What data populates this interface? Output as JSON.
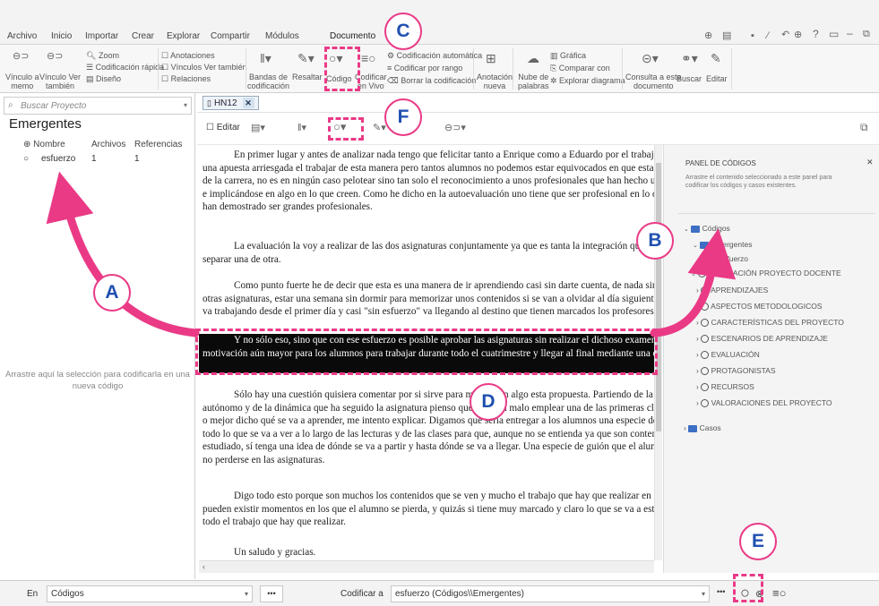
{
  "menu": [
    "Archivo",
    "Inicio",
    "Importar",
    "Crear",
    "Explorar",
    "Compartir",
    "Módulos",
    "Documento"
  ],
  "ribbon": {
    "vinculo_memo": "Vínculo a\nmemo",
    "vinculo_tambien": "Vínculo Ver\ntambién",
    "zoom": "Zoom",
    "codificacion_rapida": "Codificación rápida",
    "diseno": "Diseño",
    "anotaciones": "Anotaciones",
    "vinculos_ver_tambien": "Vínculos Ver también",
    "relaciones": "Relaciones",
    "bandas": "Bandas de\ncodificación",
    "resaltar": "Resaltar",
    "codigo": "Código",
    "codificar_vivo": "Codificar\nen Vivo",
    "codificacion_automatica": "Codificación automática",
    "codificar_por_rango": "Codificar por rango",
    "borrar_codificacion": "Borrar la codificación",
    "anotacion_nueva": "Anotación\nnueva",
    "nube_palabras": "Nube de\npalabras",
    "grafica": "Gráfica",
    "comparar_con": "Comparar con",
    "explorar_diagrama": "Explorar diagrama",
    "consulta_documento": "Consulta a este\ndocumento",
    "buscar": "Buscar",
    "editar": "Editar"
  },
  "left": {
    "search_placeholder": "Buscar Proyecto",
    "title": "Emergentes",
    "headers": [
      "Nombre",
      "Archivos",
      "Referencias"
    ],
    "rows": [
      {
        "name": "esfuerzo",
        "files": "1",
        "refs": "1"
      }
    ],
    "drop_text": "Arrastre aquí la selección para codificarla en una\nnueva código"
  },
  "doc_tab": "HN12",
  "doc_toolbar": {
    "editar": "Editar"
  },
  "document": {
    "p1": "En primer lugar y antes de analizar nada tengo que felicitar tanto a Enrique como a Eduardo por el trabajo realizado, me parece una apuesta arriesgada el trabajar de esta manera pero tantos alumnos no podemos estar equivocados en que esta es la mejor asignatura de la carrera, no es en ningún caso pelotear sino tan solo el reconocimiento a unos profesionales que han hecho un gran labor luchando e implicándose en algo en lo que creen. Como he dicho en la autoevaluación uno tiene que ser profesional en lo que trabaja y los dos han demostrado ser grandes profesionales.",
    "p2": "La evaluación la voy a realizar de las dos asignaturas conjuntamente ya que es tanta la integración que tienen que sería difícil separar una de otra.",
    "p3": "Como punto fuerte he de decir que esta es una manera de ir aprendiendo casi sin darte cuenta, de nada sirve, como ocurre en otras asignaturas, estar una semana sin dormir para memorizar unos contenidos si se van a olvidar al día siguiente. De esta manera uno va trabajando desde el primer día y casi \"sin esfuerzo\" va llegando al destino que tienen marcados los profesores.",
    "p4": "Y no sólo eso, sino que con ese esfuerzo es posible aprobar las asignaturas sin realizar el dichoso examen, lo que supone una motivación aún mayor para los alumnos para trabajar durante todo el cuatrimestre y llegar al final mediante una evaluación continua.",
    "p5": "Sólo hay una cuestión quisiera comentar por si sirve para mejorar en algo esta propuesta. Partiendo de la base del trabajo autónomo y de la dinámica que ha seguido la asignatura pienso que no sería malo emplear una de las primeras clases en explicar cómo, o mejor dicho qué se va a aprender, me intento explicar. Digamos que sería entregar a los alumnos una especie de mapa conceptual de todo lo que se va a ver a lo largo de las lecturas y de las clases para que, aunque no se entienda ya que son contenidos que aún no se han estudiado, sí tenga una idea de dónde se va a partir y hasta dónde se va a llegar. Una especie de guión que el alumno pueda tener para no perderse en las asignaturas.",
    "p6": "Digo todo esto porque son muchos los contenidos que se ven y mucho el trabajo que hay que realizar en solo un cuatrimestre y pueden existir momentos en los que el alumno se pierda, y quizás si tiene muy marcado y claro lo que se va a estudiar le sea más fácil todo el trabajo que hay que realizar.",
    "p7": "Un saludo y gracias."
  },
  "code_panel": {
    "title": "PANEL DE CÓDIGOS",
    "desc": "Arrastre el contenido seleccionado a este panel para\ncodificar los códigos y casos existentes.",
    "codigos": "Códigos",
    "emergentes": "Emergentes",
    "esfuerzo": "esfuerzo",
    "evaluacion_docente": "EVALUACIÓN PROYECTO DOCENTE",
    "children": [
      "APRENDIZAJES",
      "ASPECTOS METODOLOGICOS",
      "CARACTERÍSTICAS DEL PROYECTO",
      "ESCENARIOS DE APRENDIZAJE",
      "EVALUACIÓN",
      "PROTAGONISTAS",
      "RECURSOS",
      "VALORACIONES DEL PROYECTO"
    ],
    "casos": "Casos"
  },
  "status": {
    "en_label": "En",
    "en_value": "Códigos",
    "codificar_label": "Codificar a",
    "codificar_value": "esfuerzo (Códigos\\\\Emergentes)"
  },
  "callouts": {
    "a": "A",
    "b": "B",
    "c": "C",
    "d": "D",
    "e": "E",
    "f": "F"
  },
  "colors": {
    "accent": "#ea3a86",
    "callout_text": "#2050b0",
    "folder": "#3d6fc4",
    "highlight": "#0a0a0a"
  }
}
